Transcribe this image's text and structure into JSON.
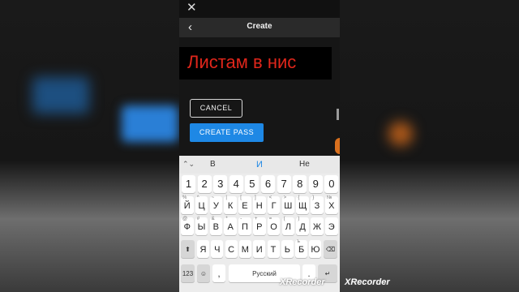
{
  "header": {
    "title": "Create",
    "close_icon": "close-icon",
    "back_icon": "chevron-left-icon"
  },
  "overlay": {
    "text": "Листам в нис"
  },
  "buttons": {
    "cancel": "CANCEL",
    "create_pass": "CREATE PASS"
  },
  "colors": {
    "accent": "#1e88e5",
    "overlay_text": "#e0261b"
  },
  "suggestions": {
    "arrow": "⌃⌄",
    "items": [
      "В",
      "И",
      "Не"
    ]
  },
  "keyboard": {
    "numbers": [
      "1",
      "2",
      "3",
      "4",
      "5",
      "6",
      "7",
      "8",
      "9",
      "0"
    ],
    "row1": {
      "keys": [
        "Й",
        "Ц",
        "У",
        "К",
        "Е",
        "Н",
        "Г",
        "Ш",
        "Щ",
        "З",
        "Х"
      ],
      "hints": [
        "%",
        "^",
        "~",
        "|",
        "[",
        "]",
        "<",
        ">",
        "{",
        "}",
        "№"
      ]
    },
    "row2": {
      "keys": [
        "Ф",
        "Ы",
        "В",
        "А",
        "П",
        "Р",
        "О",
        "Л",
        "Д",
        "Ж",
        "Э"
      ],
      "hints": [
        "@",
        "#",
        "&",
        "*",
        "-",
        "+",
        "=",
        "(",
        ")",
        "",
        ""
      ]
    },
    "row3": {
      "keys": [
        "Я",
        "Ч",
        "С",
        "М",
        "И",
        "Т",
        "Ь",
        "Б",
        "Ю"
      ],
      "hints": [
        "",
        "",
        "",
        "",
        "",
        "",
        "",
        "ъ",
        ""
      ]
    },
    "shift_icon": "shift-icon",
    "backspace_icon": "backspace-icon",
    "mode_key": "123",
    "emoji_icon": "emoji-icon",
    "comma": ",",
    "space_label": "Русский",
    "period": "."
  },
  "watermark": {
    "text": "XRecorder"
  }
}
